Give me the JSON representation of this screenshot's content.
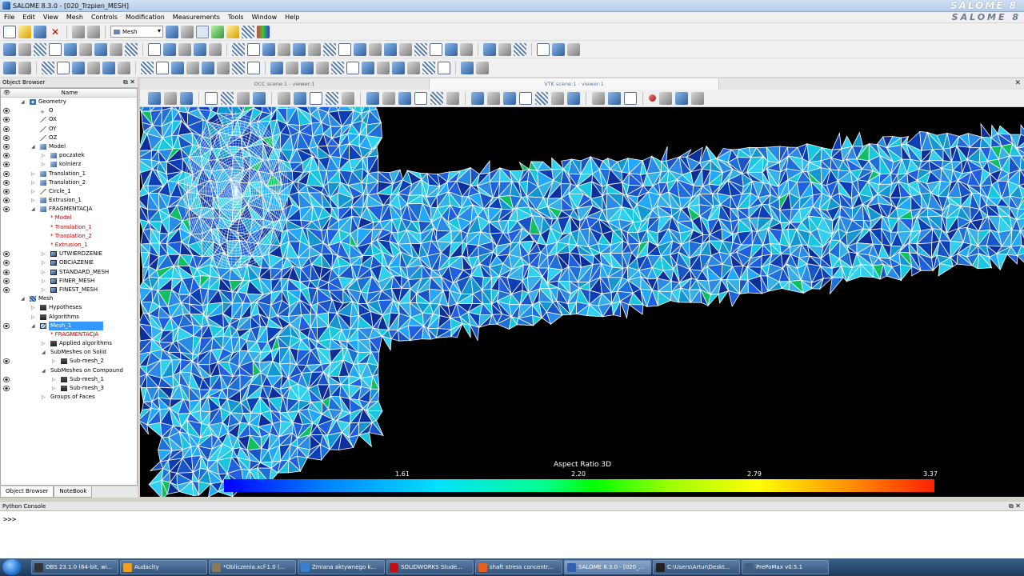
{
  "window": {
    "title": "SALOME 8.3.0 - [020_Trzpien_MESH]",
    "brand": "SALOME 8",
    "brand_menu": "SALOME 8"
  },
  "menu": [
    "File",
    "Edit",
    "View",
    "Mesh",
    "Controls",
    "Modification",
    "Measurements",
    "Tools",
    "Window",
    "Help"
  ],
  "toolbar": {
    "module_combo": "Mesh"
  },
  "object_browser": {
    "title": "Object Browser",
    "column_name": "Name",
    "tabs": [
      "Object Browser",
      "NoteBook"
    ],
    "tree": [
      {
        "label": "Geometry",
        "level": 0,
        "exp": "◢",
        "vis": false,
        "icon": "geom",
        "kind": "normal"
      },
      {
        "label": "O",
        "level": 1,
        "exp": "",
        "vis": true,
        "icon": "point",
        "kind": "normal"
      },
      {
        "label": "OX",
        "level": 1,
        "exp": "",
        "vis": true,
        "icon": "line",
        "kind": "normal"
      },
      {
        "label": "OY",
        "level": 1,
        "exp": "",
        "vis": true,
        "icon": "line",
        "kind": "normal"
      },
      {
        "label": "OZ",
        "level": 1,
        "exp": "",
        "vis": true,
        "icon": "line",
        "kind": "normal"
      },
      {
        "label": "Model",
        "level": 1,
        "exp": "◢",
        "vis": true,
        "icon": "solid",
        "kind": "normal"
      },
      {
        "label": "poczatek",
        "level": 2,
        "exp": "▷",
        "vis": true,
        "icon": "solid",
        "kind": "normal"
      },
      {
        "label": "kolnierz",
        "level": 2,
        "exp": "▷",
        "vis": true,
        "icon": "solid",
        "kind": "normal"
      },
      {
        "label": "Translation_1",
        "level": 1,
        "exp": "▷",
        "vis": true,
        "icon": "solid",
        "kind": "normal"
      },
      {
        "label": "Translation_2",
        "level": 1,
        "exp": "▷",
        "vis": true,
        "icon": "solid",
        "kind": "normal"
      },
      {
        "label": "Circle_1",
        "level": 1,
        "exp": "▷",
        "vis": true,
        "icon": "line",
        "kind": "normal"
      },
      {
        "label": "Extrusion_1",
        "level": 1,
        "exp": "▷",
        "vis": true,
        "icon": "solid",
        "kind": "normal"
      },
      {
        "label": "FRAGMENTACJA",
        "level": 1,
        "exp": "◢",
        "vis": true,
        "icon": "solid",
        "kind": "normal"
      },
      {
        "label": "* Model",
        "level": 2,
        "exp": "",
        "vis": false,
        "icon": "",
        "kind": "ref"
      },
      {
        "label": "* Translation_1",
        "level": 2,
        "exp": "",
        "vis": false,
        "icon": "",
        "kind": "ref"
      },
      {
        "label": "* Translation_2",
        "level": 2,
        "exp": "",
        "vis": false,
        "icon": "",
        "kind": "ref"
      },
      {
        "label": "* Extrusion_1",
        "level": 2,
        "exp": "",
        "vis": false,
        "icon": "",
        "kind": "ref"
      },
      {
        "label": "UTWIERDZENIE",
        "level": 2,
        "exp": "▷",
        "vis": true,
        "icon": "group",
        "kind": "normal"
      },
      {
        "label": "OBCIAZENIE",
        "level": 2,
        "exp": "▷",
        "vis": true,
        "icon": "group",
        "kind": "normal"
      },
      {
        "label": "STANDARD_MESH",
        "level": 2,
        "exp": "▷",
        "vis": true,
        "icon": "group",
        "kind": "normal"
      },
      {
        "label": "FINER_MESH",
        "level": 2,
        "exp": "▷",
        "vis": true,
        "icon": "group",
        "kind": "normal"
      },
      {
        "label": "FINEST_MESH",
        "level": 2,
        "exp": "▷",
        "vis": true,
        "icon": "group",
        "kind": "normal"
      },
      {
        "label": "Mesh",
        "level": 0,
        "exp": "◢",
        "vis": false,
        "icon": "mesh",
        "kind": "normal"
      },
      {
        "label": "Hypotheses",
        "level": 1,
        "exp": "▷",
        "vis": false,
        "icon": "hyp",
        "kind": "normal"
      },
      {
        "label": "Algorithms",
        "level": 1,
        "exp": "▷",
        "vis": false,
        "icon": "hyp",
        "kind": "normal"
      },
      {
        "label": "Mesh_1",
        "level": 1,
        "exp": "◢",
        "vis": true,
        "icon": "meshobj",
        "kind": "sel"
      },
      {
        "label": "* FRAGMENTACJA",
        "level": 2,
        "exp": "",
        "vis": false,
        "icon": "",
        "kind": "ref"
      },
      {
        "label": "Applied algorithms",
        "level": 2,
        "exp": "▷",
        "vis": false,
        "icon": "hyp",
        "kind": "normal"
      },
      {
        "label": "SubMeshes on Solid",
        "level": 2,
        "exp": "◢",
        "vis": false,
        "icon": "",
        "kind": "normal"
      },
      {
        "label": "Sub-mesh_2",
        "level": 3,
        "exp": "▷",
        "vis": true,
        "icon": "hyp",
        "kind": "normal"
      },
      {
        "label": "SubMeshes on Compound",
        "level": 2,
        "exp": "◢",
        "vis": false,
        "icon": "",
        "kind": "normal"
      },
      {
        "label": "Sub-mesh_1",
        "level": 3,
        "exp": "▷",
        "vis": true,
        "icon": "hyp",
        "kind": "normal"
      },
      {
        "label": "Sub-mesh_3",
        "level": 3,
        "exp": "▷",
        "vis": true,
        "icon": "hyp",
        "kind": "normal"
      },
      {
        "label": "Groups of Faces",
        "level": 2,
        "exp": "▷",
        "vis": false,
        "icon": "",
        "kind": "normal"
      }
    ]
  },
  "viewer": {
    "tabs": [
      "OCC scene:1 - viewer:1",
      "VTK scene:1 - viewer:1"
    ],
    "active_tab": 1,
    "scalar_bar": {
      "title": "Aspect Ratio 3D",
      "ticks": [
        "1.61",
        "2.20",
        "2.79",
        "3.37"
      ]
    }
  },
  "python_console": {
    "title": "Python Console",
    "prompt": ">>>"
  },
  "taskbar": [
    {
      "label": "OBS 23.1.0 (64-bit, wi...",
      "color": "#333333"
    },
    {
      "label": "Audacity",
      "color": "#f0a020"
    },
    {
      "label": "*Obliczenia.xcf-1.0 (...",
      "color": "#8a7a5a"
    },
    {
      "label": "Zmiana aktywnego k...",
      "color": "#3a7fd0"
    },
    {
      "label": "SOLIDWORKS Stude...",
      "color": "#c01010"
    },
    {
      "label": "shaft stress concentr...",
      "color": "#e06020"
    },
    {
      "label": "SALOME 8.3.0 - [020_...",
      "color": "#3060b0"
    },
    {
      "label": "C:\\Users\\Artur\\Deskt...",
      "color": "#202020"
    },
    {
      "label": "PrePoMax v0.5.1",
      "color": "#406080"
    }
  ],
  "colors": {
    "selection": "#3399ff",
    "reference_text": "#c00000",
    "viewport_bg": "#000000"
  }
}
